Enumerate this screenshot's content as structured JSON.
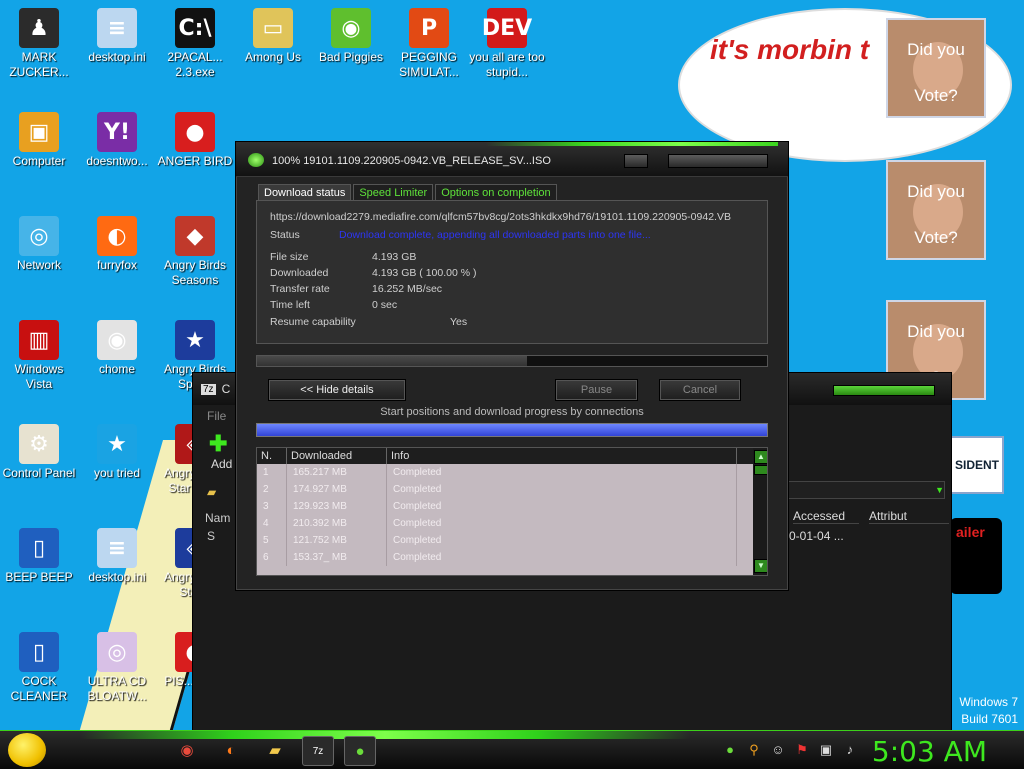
{
  "desktop_icons": [
    {
      "label": "MARK ZUCKER...",
      "icon": "user-icon",
      "color": "#2b2b2b",
      "glyph": "♟"
    },
    {
      "label": "desktop.ini",
      "icon": "text-file-icon",
      "color": "#bcd7f0",
      "glyph": "≡"
    },
    {
      "label": "2PACAL... 2.3.exe",
      "icon": "console-icon",
      "color": "#111111",
      "glyph": "C:\\"
    },
    {
      "label": "Among Us",
      "icon": "folder-icon",
      "color": "#e0c45a",
      "glyph": "▭"
    },
    {
      "label": "Bad Piggies",
      "icon": "pig-icon",
      "color": "#5fbf2e",
      "glyph": "◉"
    },
    {
      "label": "PEGGING SIMULAT...",
      "icon": "p-logo-icon",
      "color": "#e24a14",
      "glyph": "P"
    },
    {
      "label": "you all are too stupid...",
      "icon": "dev-icon",
      "color": "#d31a1a",
      "glyph": "DEV"
    },
    {
      "label": "Computer",
      "icon": "computer-icon",
      "color": "#e8a020",
      "glyph": "▣"
    },
    {
      "label": "doesntwo...",
      "icon": "yahoo-icon",
      "color": "#7a2da6",
      "glyph": "Y!"
    },
    {
      "label": "ANGER BIRD",
      "icon": "angry-bird-icon",
      "color": "#d81e1e",
      "glyph": "●"
    },
    {
      "label": "Network",
      "icon": "network-icon",
      "color": "#46b4e8",
      "glyph": "◎"
    },
    {
      "label": "furryfox",
      "icon": "firefox-icon",
      "color": "#ff6a12",
      "glyph": "◐"
    },
    {
      "label": "Angry Birds Seasons",
      "icon": "seasons-icon",
      "color": "#c0392b",
      "glyph": "◆"
    },
    {
      "label": "Windows Vista",
      "icon": "recycle-bin-icon",
      "color": "#c81010",
      "glyph": "▥"
    },
    {
      "label": "chome",
      "icon": "chrome-icon",
      "color": "#e3e3e3",
      "glyph": "◉"
    },
    {
      "label": "Angry Birds Space",
      "icon": "space-icon",
      "color": "#1d3c9c",
      "glyph": "★"
    },
    {
      "label": "Control Panel",
      "icon": "control-panel-icon",
      "color": "#e7e2d0",
      "glyph": "⚙"
    },
    {
      "label": "you tried",
      "icon": "star-icon",
      "color": "#1aa3e3",
      "glyph": "★"
    },
    {
      "label": "Angry Birds Star Wars",
      "icon": "starwars-icon",
      "color": "#b01818",
      "glyph": "◈"
    },
    {
      "label": "BEEP BEEP",
      "icon": "blue-shortcut-icon",
      "color": "#1f5fbf",
      "glyph": "▯"
    },
    {
      "label": "desktop.ini",
      "icon": "text-file-icon",
      "color": "#bcd7f0",
      "glyph": "≡"
    },
    {
      "label": "Angry Birds Star...",
      "icon": "angry-bird-icon",
      "color": "#1d3c9c",
      "glyph": "◈"
    },
    {
      "label": "COCK CLEANER",
      "icon": "blue-shortcut-icon",
      "color": "#1f5fbf",
      "glyph": "▯"
    },
    {
      "label": "ULTRA CD BLOATW...",
      "icon": "cd-icon",
      "color": "#d8c0e6",
      "glyph": "◎"
    },
    {
      "label": "PIS... BIRD",
      "icon": "angry-bird-icon",
      "color": "#d81e1e",
      "glyph": "●"
    }
  ],
  "meme": {
    "bubble_text": "it's morbin t",
    "posters": [
      {
        "top": "Did you",
        "bottom": "Vote?"
      },
      {
        "top": "Did you",
        "bottom": "Vote?"
      },
      {
        "top": "Did you",
        "bottom": "?"
      }
    ]
  },
  "bg_window": {
    "title": "C",
    "menu": "File",
    "add": "Add",
    "col_accessed": "Accessed",
    "col_attrib": "Attribut",
    "row_name": "S",
    "row_date": "0-01-04 ...",
    "side_badge": "SIDENT",
    "side_ad": "ailer"
  },
  "dialog": {
    "title": "100% 19101.1109.220905-0942.VB_RELEASE_SV...ISO",
    "tabs": [
      "Download status",
      "Speed Limiter",
      "Options on completion"
    ],
    "url": "https://download2279.mediafire.com/qlfcm57bv8cg/2ots3hkdkx9hd76/19101.1109.220905-0942.VB",
    "status_label": "Status",
    "status_value": "Download complete, appending all downloaded parts into one file...",
    "file_size_label": "File size",
    "file_size": "4.193  GB",
    "downloaded_label": "Downloaded",
    "downloaded": "4.193  GB  ( 100.00 % )",
    "rate_label": "Transfer rate",
    "rate": "16.252  MB/sec",
    "time_left_label": "Time left",
    "time_left": "0 sec",
    "resume_label": "Resume capability",
    "resume": "Yes",
    "progress_fraction": 0.53,
    "hide_details": "<< Hide details",
    "pause": "Pause",
    "cancel": "Cancel",
    "connections_label": "Start positions and download progress by connections",
    "columns": [
      "N.",
      "Downloaded",
      "Info"
    ],
    "rows": [
      {
        "n": "1",
        "downloaded": "165.217 MB",
        "info": "Completed"
      },
      {
        "n": "2",
        "downloaded": "174.927 MB",
        "info": "Completed"
      },
      {
        "n": "3",
        "downloaded": "129.923 MB",
        "info": "Completed"
      },
      {
        "n": "4",
        "downloaded": "210.392 MB",
        "info": "Completed"
      },
      {
        "n": "5",
        "downloaded": "121.752 MB",
        "info": "Completed"
      },
      {
        "n": "6",
        "downloaded": "153.37_ MB",
        "info": "Completed"
      }
    ]
  },
  "taskbar": {
    "time": "5:03 AM",
    "os_line1": "Windows 7",
    "os_line2": "Build 7601"
  },
  "colors": {
    "accent": "#3ee81f",
    "desktop": "#12a4e7",
    "status": "#2d35f5"
  }
}
